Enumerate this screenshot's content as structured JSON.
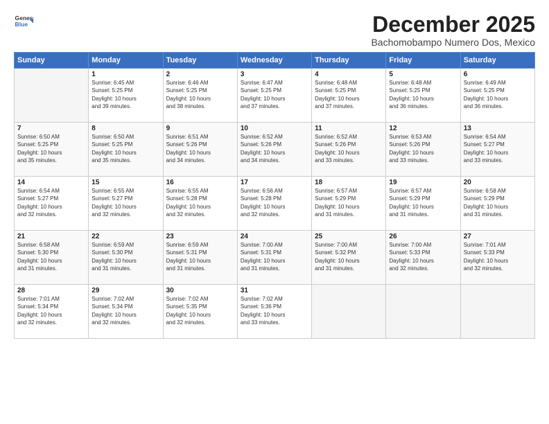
{
  "logo": {
    "general": "General",
    "blue": "Blue"
  },
  "title": "December 2025",
  "location": "Bachomobampo Numero Dos, Mexico",
  "weekdays": [
    "Sunday",
    "Monday",
    "Tuesday",
    "Wednesday",
    "Thursday",
    "Friday",
    "Saturday"
  ],
  "weeks": [
    [
      {
        "day": "",
        "info": ""
      },
      {
        "day": "1",
        "info": "Sunrise: 6:45 AM\nSunset: 5:25 PM\nDaylight: 10 hours\nand 39 minutes."
      },
      {
        "day": "2",
        "info": "Sunrise: 6:46 AM\nSunset: 5:25 PM\nDaylight: 10 hours\nand 38 minutes."
      },
      {
        "day": "3",
        "info": "Sunrise: 6:47 AM\nSunset: 5:25 PM\nDaylight: 10 hours\nand 37 minutes."
      },
      {
        "day": "4",
        "info": "Sunrise: 6:48 AM\nSunset: 5:25 PM\nDaylight: 10 hours\nand 37 minutes."
      },
      {
        "day": "5",
        "info": "Sunrise: 6:48 AM\nSunset: 5:25 PM\nDaylight: 10 hours\nand 36 minutes."
      },
      {
        "day": "6",
        "info": "Sunrise: 6:49 AM\nSunset: 5:25 PM\nDaylight: 10 hours\nand 36 minutes."
      }
    ],
    [
      {
        "day": "7",
        "info": "Sunrise: 6:50 AM\nSunset: 5:25 PM\nDaylight: 10 hours\nand 35 minutes."
      },
      {
        "day": "8",
        "info": "Sunrise: 6:50 AM\nSunset: 5:25 PM\nDaylight: 10 hours\nand 35 minutes."
      },
      {
        "day": "9",
        "info": "Sunrise: 6:51 AM\nSunset: 5:26 PM\nDaylight: 10 hours\nand 34 minutes."
      },
      {
        "day": "10",
        "info": "Sunrise: 6:52 AM\nSunset: 5:26 PM\nDaylight: 10 hours\nand 34 minutes."
      },
      {
        "day": "11",
        "info": "Sunrise: 6:52 AM\nSunset: 5:26 PM\nDaylight: 10 hours\nand 33 minutes."
      },
      {
        "day": "12",
        "info": "Sunrise: 6:53 AM\nSunset: 5:26 PM\nDaylight: 10 hours\nand 33 minutes."
      },
      {
        "day": "13",
        "info": "Sunrise: 6:54 AM\nSunset: 5:27 PM\nDaylight: 10 hours\nand 33 minutes."
      }
    ],
    [
      {
        "day": "14",
        "info": "Sunrise: 6:54 AM\nSunset: 5:27 PM\nDaylight: 10 hours\nand 32 minutes."
      },
      {
        "day": "15",
        "info": "Sunrise: 6:55 AM\nSunset: 5:27 PM\nDaylight: 10 hours\nand 32 minutes."
      },
      {
        "day": "16",
        "info": "Sunrise: 6:55 AM\nSunset: 5:28 PM\nDaylight: 10 hours\nand 32 minutes."
      },
      {
        "day": "17",
        "info": "Sunrise: 6:56 AM\nSunset: 5:28 PM\nDaylight: 10 hours\nand 32 minutes."
      },
      {
        "day": "18",
        "info": "Sunrise: 6:57 AM\nSunset: 5:29 PM\nDaylight: 10 hours\nand 31 minutes."
      },
      {
        "day": "19",
        "info": "Sunrise: 6:57 AM\nSunset: 5:29 PM\nDaylight: 10 hours\nand 31 minutes."
      },
      {
        "day": "20",
        "info": "Sunrise: 6:58 AM\nSunset: 5:29 PM\nDaylight: 10 hours\nand 31 minutes."
      }
    ],
    [
      {
        "day": "21",
        "info": "Sunrise: 6:58 AM\nSunset: 5:30 PM\nDaylight: 10 hours\nand 31 minutes."
      },
      {
        "day": "22",
        "info": "Sunrise: 6:59 AM\nSunset: 5:30 PM\nDaylight: 10 hours\nand 31 minutes."
      },
      {
        "day": "23",
        "info": "Sunrise: 6:59 AM\nSunset: 5:31 PM\nDaylight: 10 hours\nand 31 minutes."
      },
      {
        "day": "24",
        "info": "Sunrise: 7:00 AM\nSunset: 5:31 PM\nDaylight: 10 hours\nand 31 minutes."
      },
      {
        "day": "25",
        "info": "Sunrise: 7:00 AM\nSunset: 5:32 PM\nDaylight: 10 hours\nand 31 minutes."
      },
      {
        "day": "26",
        "info": "Sunrise: 7:00 AM\nSunset: 5:33 PM\nDaylight: 10 hours\nand 32 minutes."
      },
      {
        "day": "27",
        "info": "Sunrise: 7:01 AM\nSunset: 5:33 PM\nDaylight: 10 hours\nand 32 minutes."
      }
    ],
    [
      {
        "day": "28",
        "info": "Sunrise: 7:01 AM\nSunset: 5:34 PM\nDaylight: 10 hours\nand 32 minutes."
      },
      {
        "day": "29",
        "info": "Sunrise: 7:02 AM\nSunset: 5:34 PM\nDaylight: 10 hours\nand 32 minutes."
      },
      {
        "day": "30",
        "info": "Sunrise: 7:02 AM\nSunset: 5:35 PM\nDaylight: 10 hours\nand 32 minutes."
      },
      {
        "day": "31",
        "info": "Sunrise: 7:02 AM\nSunset: 5:36 PM\nDaylight: 10 hours\nand 33 minutes."
      },
      {
        "day": "",
        "info": ""
      },
      {
        "day": "",
        "info": ""
      },
      {
        "day": "",
        "info": ""
      }
    ]
  ]
}
